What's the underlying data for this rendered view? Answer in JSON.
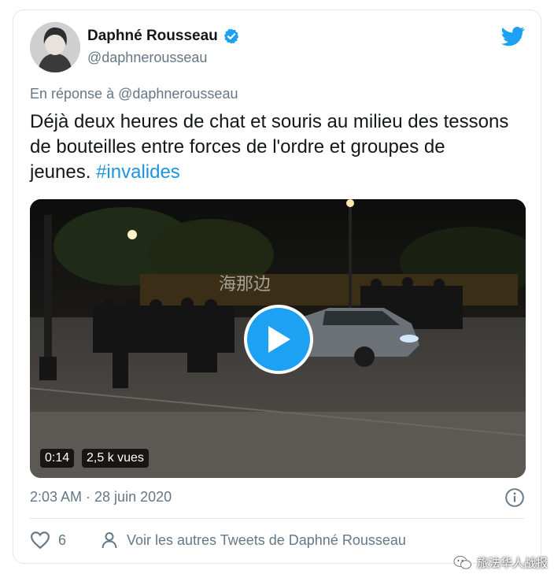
{
  "author": {
    "name": "Daphné Rousseau",
    "handle": "@daphnerousseau",
    "verified": true
  },
  "reply_to": "En réponse à @daphnerousseau",
  "tweet": {
    "text": "Déjà deux heures de chat et souris au milieu des tessons de bouteilles entre forces de l'ordre et groupes de jeunes. ",
    "hashtag": "#invalides"
  },
  "video": {
    "duration": "0:14",
    "views": "2,5 k vues",
    "overlay_watermark": "海那边"
  },
  "timestamp": "2:03 AM · 28 juin 2020",
  "actions": {
    "likes": "6",
    "more_tweets": "Voir les autres Tweets de Daphné Rousseau"
  },
  "footer_watermark": "旅法华人战报",
  "colors": {
    "twitter_blue": "#1da1f2",
    "link_blue": "#1b95e0",
    "secondary_text": "#657786"
  },
  "icons": [
    "verified-badge-icon",
    "twitter-bird-icon",
    "play-icon",
    "info-icon",
    "heart-icon",
    "user-icon",
    "wechat-icon"
  ]
}
